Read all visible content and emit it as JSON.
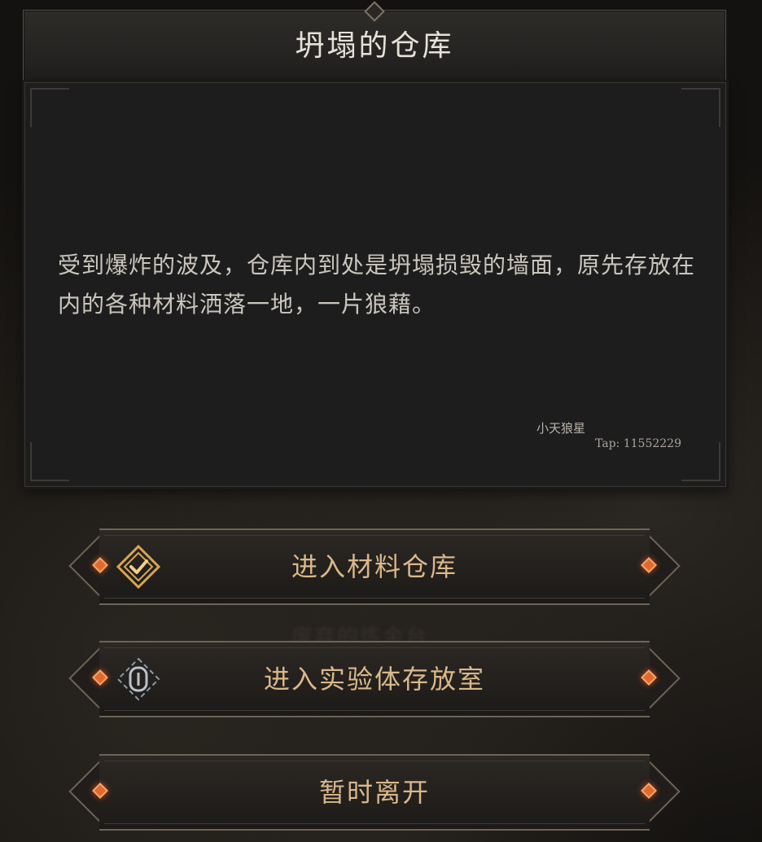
{
  "event": {
    "title": "坍塌的仓库",
    "description": "受到爆炸的波及，仓库内到处是坍塌损毁的墙面，原先存放在内的各种材料洒落一地，一片狼藉。",
    "watermark_name": "小天狼星",
    "watermark_tap": "Tap: 11552229"
  },
  "background": {
    "ghost_text": "废弃的炼金台"
  },
  "choices": [
    {
      "label": "进入材料仓库",
      "icon": "checkmark-badge-icon"
    },
    {
      "label": "进入实验体存放室",
      "icon": "capsule-door-icon"
    },
    {
      "label": "暂时离开",
      "icon": ""
    }
  ],
  "colors": {
    "choice_text": "#d9b88a",
    "accent_gem": "#e06a2c",
    "icon_gold": "#d9a552",
    "icon_steel": "#8d9aa6"
  }
}
